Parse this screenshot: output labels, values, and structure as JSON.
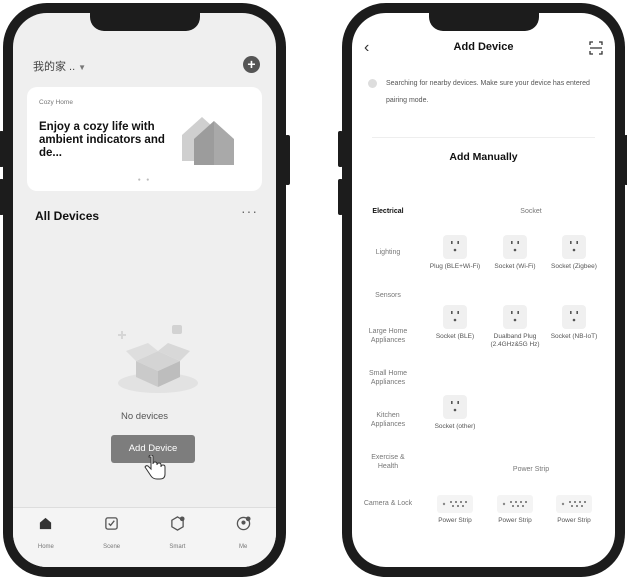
{
  "left_phone": {
    "home_name": "我的家 ..",
    "banner": {
      "small_label": "Cozy Home",
      "title": "Enjoy a cozy life with ambient indicators and de..."
    },
    "section_title": "All Devices",
    "more": "···",
    "empty_text": "No devices",
    "add_button": "Add Device",
    "tabs": [
      {
        "label": "Home",
        "icon": "home-icon"
      },
      {
        "label": "Scene",
        "icon": "scene-icon"
      },
      {
        "label": "Smart",
        "icon": "smart-icon"
      },
      {
        "label": "Me",
        "icon": "me-icon"
      }
    ]
  },
  "right_phone": {
    "title": "Add Device",
    "back": "‹",
    "searching_text": "Searching for nearby devices. Make sure your device has entered pairing mode.",
    "add_manually": "Add Manually",
    "categories": [
      "Electrical",
      "Lighting",
      "Sensors",
      "Large Home Appliances",
      "Small Home Appliances",
      "Kitchen Appliances",
      "Exercise & Health",
      "Camera & Lock"
    ],
    "socket_section": {
      "title": "Socket",
      "devices": [
        {
          "label": "Plug (BLE+Wi-Fi)"
        },
        {
          "label": "Socket (Wi-Fi)"
        },
        {
          "label": "Socket (Zigbee)"
        },
        {
          "label": "Socket (BLE)"
        },
        {
          "label": "Dualband Plug (2.4GHz&5G Hz)"
        },
        {
          "label": "Socket (NB-IoT)"
        },
        {
          "label": "Socket (other)"
        }
      ]
    },
    "strip_section": {
      "title": "Power Strip",
      "devices": [
        {
          "label": "Power Strip"
        },
        {
          "label": "Power Strip"
        },
        {
          "label": "Power Strip"
        }
      ]
    }
  }
}
